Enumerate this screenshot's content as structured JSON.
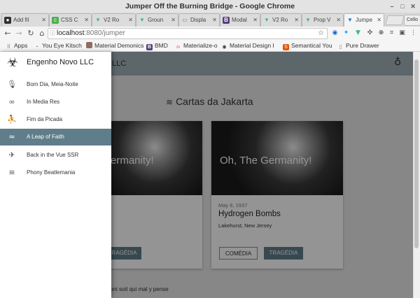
{
  "window": {
    "title": "Jumper Off the Burning Bridge - Google Chrome"
  },
  "tabs": [
    {
      "label": "Add fil",
      "icon": "github-icon",
      "active": false
    },
    {
      "label": "CSS C",
      "icon": "css-icon",
      "active": false
    },
    {
      "label": "V2 Ro",
      "icon": "vue-icon",
      "active": false
    },
    {
      "label": "Groun",
      "icon": "vue-icon",
      "active": false
    },
    {
      "label": "Displa",
      "icon": "page-icon",
      "active": false
    },
    {
      "label": "Modal",
      "icon": "bootstrap-icon",
      "active": false
    },
    {
      "label": "V2 Ro",
      "icon": "vue-icon",
      "active": false
    },
    {
      "label": "Prop V",
      "icon": "vue-icon",
      "active": false
    },
    {
      "label": "Jumpe",
      "icon": "vuetify-icon",
      "active": true
    }
  ],
  "profile_badge": "Cello",
  "url": {
    "host": "localhost",
    "path": ":8080/jumper"
  },
  "bookmarks": [
    {
      "label": "Apps",
      "icon": "apps-icon"
    },
    {
      "label": "You Eye Kitsch",
      "icon": "bookmark-icon"
    },
    {
      "label": "Material Demonics",
      "icon": "bookmark-icon"
    },
    {
      "label": "BMD",
      "icon": "bootstrap-icon"
    },
    {
      "label": "Materialize-o",
      "icon": "materialize-icon"
    },
    {
      "label": "Material Design I",
      "icon": "bookmark-icon"
    },
    {
      "label": "Semantical You",
      "icon": "bookmark-icon"
    },
    {
      "label": "Pure Drawer",
      "icon": "page-icon"
    }
  ],
  "page": {
    "toolbar_title_fragment": "LLC",
    "section_title": "Cartas da Jakarta",
    "card_left_title_fragment": "ermanity!",
    "card_left_button": "TRAGÉDIA",
    "card_right": {
      "image_title": "Oh, The Germanity!",
      "date": "May 6, 1937",
      "title": "Hydrogen Bombs",
      "location": "Lakehurst, New Jersey",
      "btn_comedy": "COMÉDIA",
      "btn_tragedy": "TRAGÉDIA"
    },
    "footer_fragment": "e honi soit qui mal y pense"
  },
  "drawer": {
    "title": "Engenho Novo LLC",
    "items": [
      {
        "label": "Bom Dia, Meia-Noite",
        "icon": "mic-icon",
        "active": false
      },
      {
        "label": "In Media Res",
        "icon": "infinity-icon",
        "active": false
      },
      {
        "label": "Fim da Picada",
        "icon": "walk-icon",
        "active": false
      },
      {
        "label": "A Leap of Faith",
        "icon": "pool-icon",
        "active": true
      },
      {
        "label": "Back in the Vue SSR",
        "icon": "airplane-icon",
        "active": false
      },
      {
        "label": "Phony Beatlemania",
        "icon": "playlist-icon",
        "active": false
      }
    ]
  },
  "colors": {
    "accent": "#607d8b",
    "appbar": "#9fb0b8"
  }
}
